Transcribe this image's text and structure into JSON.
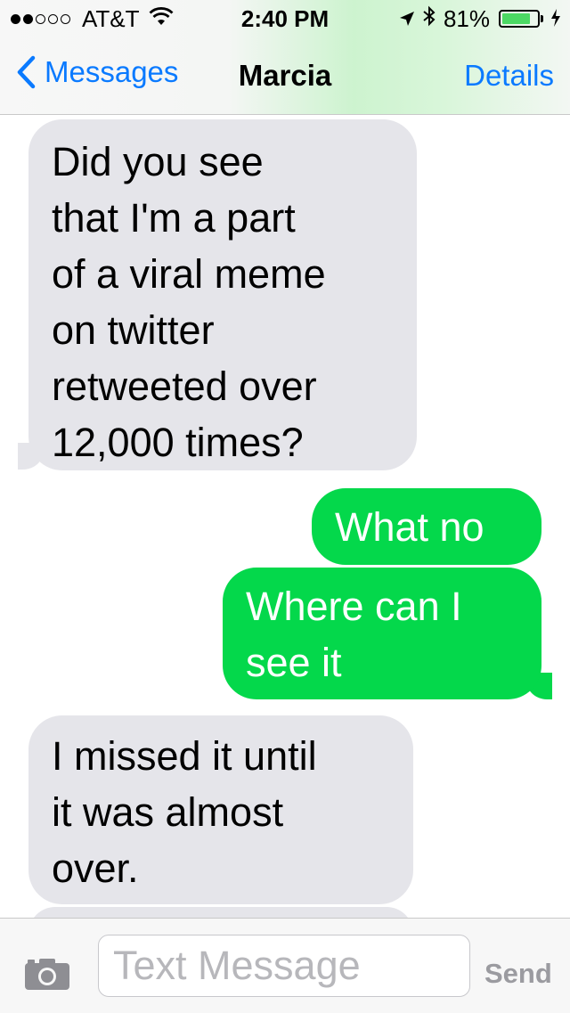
{
  "status_bar": {
    "signal_filled": 2,
    "signal_total": 5,
    "carrier": "AT&T",
    "time": "2:40 PM",
    "battery_text": "81%",
    "battery_level": 0.81
  },
  "nav": {
    "back_label": "Messages",
    "title": "Marcia",
    "details_label": "Details"
  },
  "messages": [
    {
      "direction": "incoming",
      "lines": [
        "Did you see",
        "that I'm a part",
        "of a viral meme",
        "on twitter",
        "retweeted over",
        "12,000 times?"
      ]
    },
    {
      "direction": "outgoing",
      "lines": [
        "What no"
      ]
    },
    {
      "direction": "outgoing",
      "lines": [
        "Where can I",
        "see it"
      ]
    },
    {
      "direction": "incoming",
      "lines": [
        "I missed it until",
        "it was almost",
        "over."
      ]
    }
  ],
  "input": {
    "placeholder": "Text Message",
    "value": "",
    "send_label": "Send"
  },
  "colors": {
    "incoming_bubble": "#e5e5ea",
    "outgoing_bubble": "#04d84b",
    "accent": "#0a7aff",
    "battery_fill": "#4cd964"
  },
  "icons": {
    "wifi": "wifi-icon",
    "location": "location-arrow-icon",
    "bluetooth": "bluetooth-icon",
    "charging": "bolt-icon",
    "back": "chevron-left-icon",
    "camera": "camera-icon"
  }
}
